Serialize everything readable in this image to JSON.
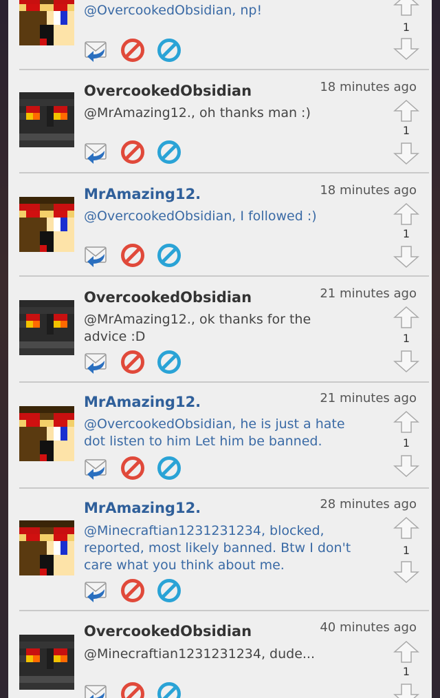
{
  "comments": [
    {
      "username": "",
      "time": "",
      "text": "@OvercookedObsidian, np!",
      "votes": "1",
      "avatar": "mramazing"
    },
    {
      "username": "OvercookedObsidian",
      "time": "18 minutes ago",
      "text": "@MrAmazing12., oh thanks man :)",
      "votes": "1",
      "avatar": "overcooked"
    },
    {
      "username": "MrAmazing12.",
      "time": "18 minutes ago",
      "text": "@OvercookedObsidian, I followed :)",
      "votes": "1",
      "avatar": "mramazing"
    },
    {
      "username": "OvercookedObsidian",
      "time": "21 minutes ago",
      "text": "@MrAmazing12., ok thanks for the advice :D",
      "votes": "1",
      "avatar": "overcooked"
    },
    {
      "username": "MrAmazing12.",
      "time": "21 minutes ago",
      "text": "@OvercookedObsidian, he is just a hate dot listen to him Let him be banned.",
      "votes": "1",
      "avatar": "mramazing"
    },
    {
      "username": "MrAmazing12.",
      "time": "28 minutes ago",
      "text": "@Minecraftian1231231234, blocked, reported, most likely banned. Btw I don't care what you think about me.",
      "votes": "1",
      "avatar": "mramazing"
    },
    {
      "username": "OvercookedObsidian",
      "time": "40 minutes ago",
      "text": "@Minecraftian1231231234, dude...",
      "votes": "1",
      "avatar": "overcooked"
    }
  ],
  "colors": {
    "mramazing_text": "#3a6aa5",
    "mramazing_name": "#2f5f9a",
    "overcooked_text": "#444444",
    "block_icon": "#e0493a",
    "hide_icon": "#2aa3d6",
    "reply_icon": "#2a6fbf"
  },
  "icons": {
    "reply": "reply-envelope-icon",
    "block": "block-icon",
    "hide": "hide-icon",
    "upvote": "up-arrow-icon",
    "downvote": "down-arrow-icon"
  }
}
